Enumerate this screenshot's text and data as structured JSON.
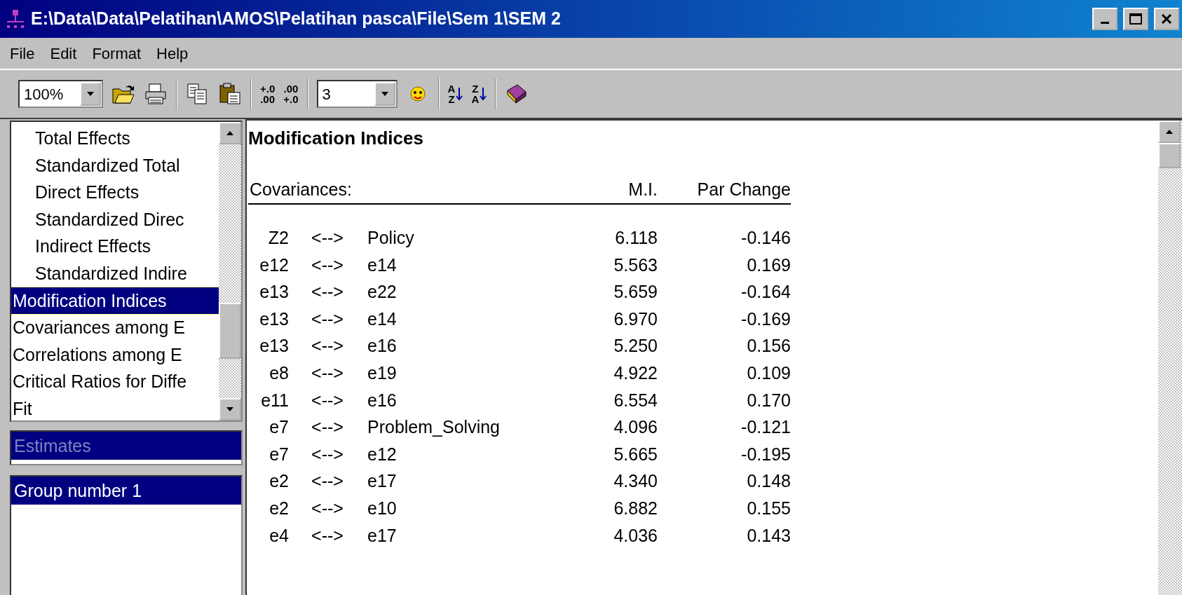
{
  "window": {
    "title": "E:\\Data\\Data\\Pelatihan\\AMOS\\Pelatihan pasca\\File\\Sem 1\\SEM 2"
  },
  "menu": [
    {
      "label": "File"
    },
    {
      "label": "Edit"
    },
    {
      "label": "Format"
    },
    {
      "label": "Help"
    }
  ],
  "toolbar": {
    "zoom": {
      "value": "100%"
    },
    "decimal_buttons": [
      {
        "top": "+.0",
        "bottom": ".00"
      },
      {
        "top": ".00",
        "bottom": "+.0"
      }
    ],
    "decimals": {
      "value": "3"
    },
    "sort_buttons": [
      {
        "top": "A",
        "bottom": "Z"
      },
      {
        "top": "Z",
        "bottom": "A"
      }
    ]
  },
  "nav": {
    "items": [
      {
        "children": [
          {
            "label": "Total Effects",
            "selected": false
          },
          {
            "label": "Standardized Total",
            "selected": false
          },
          {
            "label": "Direct Effects",
            "selected": false
          },
          {
            "label": "Standardized Direc",
            "selected": false
          },
          {
            "label": "Indirect Effects",
            "selected": false
          },
          {
            "label": "Standardized Indire",
            "selected": false
          }
        ]
      },
      {
        "label": "Modification Indices",
        "selected": true
      },
      {
        "label": "Covariances among E",
        "selected": false
      },
      {
        "label": "Correlations among E",
        "selected": false
      },
      {
        "label": "Critical Ratios for Diffe",
        "selected": false
      },
      {
        "label": "Fit",
        "selected": false
      }
    ]
  },
  "estimates": {
    "label": "Estimates"
  },
  "groups": [
    {
      "label": "Group number 1",
      "selected": true
    }
  ],
  "output": {
    "heading": "Modification Indices",
    "columns": [
      "Covariances:",
      "M.I.",
      "Par Change"
    ],
    "rows": [
      {
        "from": "Z2",
        "arrow": "<-->",
        "to": "Policy",
        "mi": "6.118",
        "par_change": "-0.146"
      },
      {
        "from": "e12",
        "arrow": "<-->",
        "to": "e14",
        "mi": "5.563",
        "par_change": "0.169"
      },
      {
        "from": "e13",
        "arrow": "<-->",
        "to": "e22",
        "mi": "5.659",
        "par_change": "-0.164"
      },
      {
        "from": "e13",
        "arrow": "<-->",
        "to": "e14",
        "mi": "6.970",
        "par_change": "-0.169"
      },
      {
        "from": "e13",
        "arrow": "<-->",
        "to": "e16",
        "mi": "5.250",
        "par_change": "0.156"
      },
      {
        "from": "e8",
        "arrow": "<-->",
        "to": "e19",
        "mi": "4.922",
        "par_change": "0.109"
      },
      {
        "from": "e11",
        "arrow": "<-->",
        "to": "e16",
        "mi": "6.554",
        "par_change": "0.170"
      },
      {
        "from": "e7",
        "arrow": "<-->",
        "to": "Problem_Solving",
        "mi": "4.096",
        "par_change": "-0.121"
      },
      {
        "from": "e7",
        "arrow": "<-->",
        "to": "e12",
        "mi": "5.665",
        "par_change": "-0.195"
      },
      {
        "from": "e2",
        "arrow": "<-->",
        "to": "e17",
        "mi": "4.340",
        "par_change": "0.148"
      },
      {
        "from": "e2",
        "arrow": "<-->",
        "to": "e10",
        "mi": "6.882",
        "par_change": "0.155"
      },
      {
        "from": "e4",
        "arrow": "<-->",
        "to": "e17",
        "mi": "4.036",
        "par_change": "0.143"
      }
    ]
  }
}
